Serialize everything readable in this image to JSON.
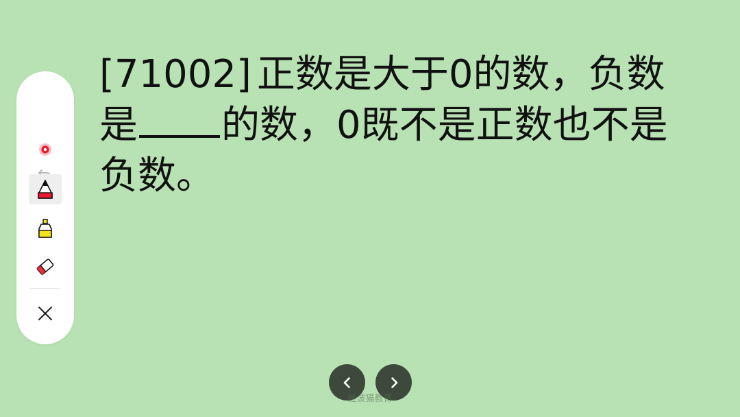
{
  "question": {
    "id": "[71002]",
    "part1": "正数是大于0的数，负数是",
    "part2": "的数，0既不是正数也不是负数。"
  },
  "toolbar": {
    "tools": [
      {
        "name": "undo",
        "icon": "undo-icon"
      },
      {
        "name": "laser-pointer",
        "icon": "laser-pointer-icon",
        "color": "#e8192c"
      },
      {
        "name": "pen",
        "icon": "pen-icon",
        "color": "#e8192c",
        "selected": true
      },
      {
        "name": "highlighter",
        "icon": "highlighter-icon",
        "color": "#f2e21a"
      },
      {
        "name": "eraser",
        "icon": "eraser-icon",
        "color": "#e8192c"
      },
      {
        "name": "close",
        "icon": "close-icon"
      }
    ]
  },
  "navigation": {
    "prev_icon": "chevron-left-icon",
    "next_icon": "chevron-right-icon"
  },
  "watermark": "蛙波猫教育",
  "colors": {
    "background": "#b9e2b4",
    "text": "#111111",
    "nav_button": "#3d4a3b",
    "accent_red": "#e8192c",
    "accent_yellow": "#f2e21a"
  }
}
